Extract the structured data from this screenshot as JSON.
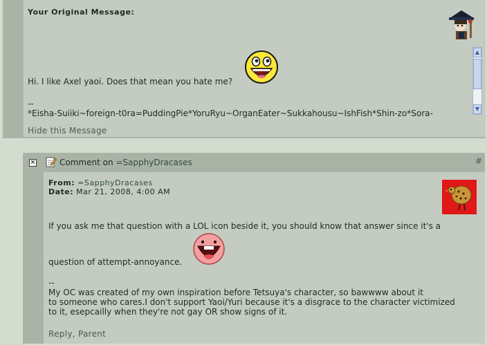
{
  "original": {
    "title": "Your Original Message:",
    "message": "Hi. I like Axel yaoi. Does that mean you hate me?",
    "sig_dash": "--",
    "sig": "*Eisha-Suiiki~foreign-t0ra=PuddingPie*YoruRyu~OrganEater~Sukkahousu~IshFish*Shin-zo*Sora-",
    "hide_label": "Hide this Message",
    "avatar_icon": "witch-avatar-icon",
    "emote_icon": "awesome-face-icon"
  },
  "comment": {
    "close_icon": "close-icon",
    "edit_icon": "edit-icon",
    "header_prefix": "Comment on ",
    "header_user": "=SapphyDracases",
    "hash": "#",
    "from_label": "From:",
    "from_user": "=SapphyDracases",
    "date_label": "Date:",
    "date_value": "Mar 21, 2008, 4:00 AM",
    "avatar_icon": "cookie-bird-avatar-icon",
    "emote_icon": "lol-face-icon",
    "text1": "If you ask me that question with a LOL icon beside it, you should know that answer since it's a",
    "text2": "question of attempt-annoyance.",
    "sig_dash": "--",
    "sig_line1": "My OC was created of my own inspiration before Tetsuya's character, so bawwww about it",
    "sig_line2": "to someone who cares.I don't support Yaoi/Yuri because it's a disgrace to the character victimized",
    "sig_line3": "to it, esepcailly when they're not gay OR show signs of it.",
    "reply_label": "Reply",
    "parent_label": "Parent",
    "sep": ", "
  },
  "colors": {
    "page_bg": "#d4dcd0",
    "panel_dark": "#aab4a6",
    "panel_light": "#c4ccc1",
    "avatar_red": "#e01818"
  }
}
